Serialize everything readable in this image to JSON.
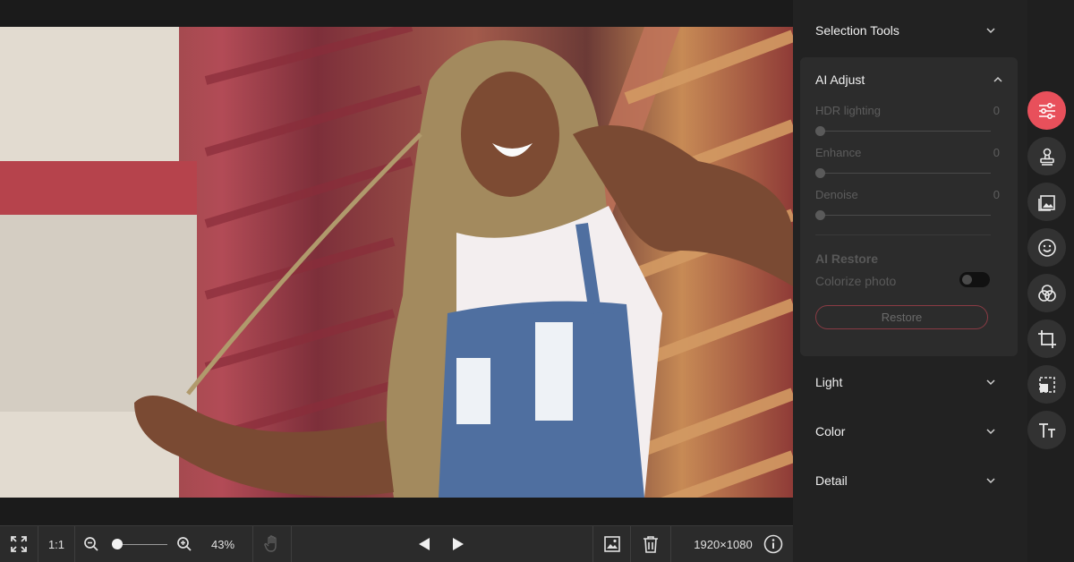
{
  "canvas": {
    "photo_alt": "portrait photo"
  },
  "toolbar": {
    "fit_icon": "expand-icon",
    "ratio_label": "1:1",
    "zoom_percent": "43%",
    "zoom_level": 0.1,
    "dimensions": "1920×1080"
  },
  "panel": {
    "selection_tools": "Selection Tools",
    "ai_adjust": {
      "title": "AI Adjust",
      "sliders": [
        {
          "label": "HDR lighting",
          "value": "0"
        },
        {
          "label": "Enhance",
          "value": "0"
        },
        {
          "label": "Denoise",
          "value": "0"
        }
      ],
      "restore_title": "AI Restore",
      "colorize_label": "Colorize photo",
      "colorize_on": false,
      "restore_button": "Restore"
    },
    "light": "Light",
    "color": "Color",
    "detail": "Detail"
  },
  "rail": {
    "items": [
      "adjust-icon",
      "stamp-icon",
      "image-icon",
      "face-icon",
      "color-circles-icon",
      "crop-icon",
      "resize-icon",
      "text-icon"
    ],
    "active": "adjust-icon"
  },
  "colors": {
    "accent": "#e8505b",
    "panel_bg": "#222222",
    "card_bg": "#2c2c2c"
  }
}
